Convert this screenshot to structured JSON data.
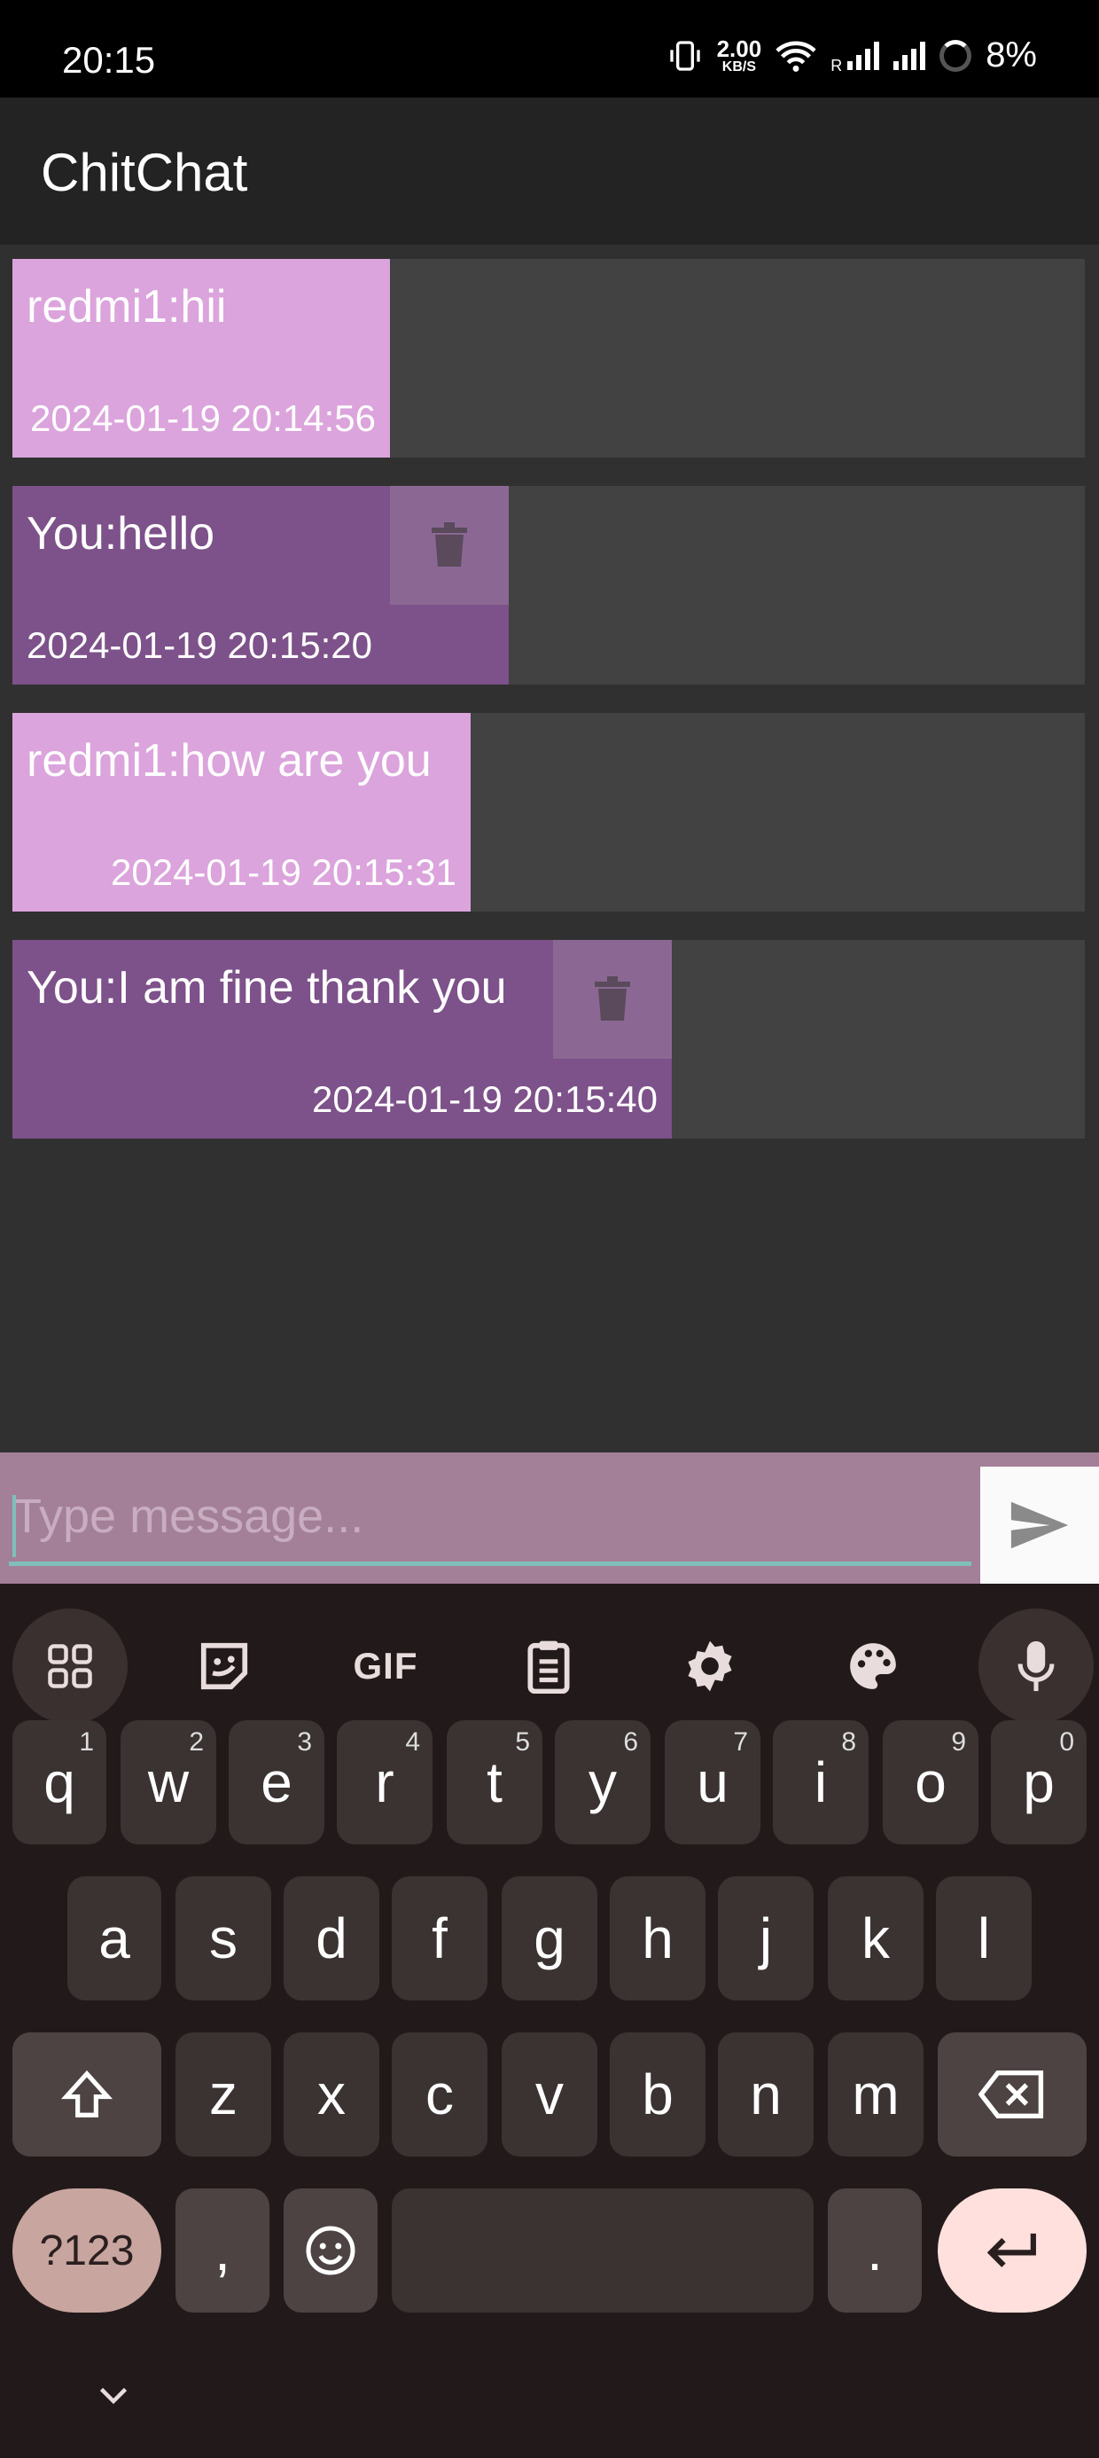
{
  "status_bar": {
    "time": "20:15",
    "net_speed_value": "2.00",
    "net_speed_unit": "KB/S",
    "roaming": "R",
    "battery": "8%"
  },
  "app_bar": {
    "title": "ChitChat"
  },
  "messages": [
    {
      "sender": "redmi1",
      "text": "redmi1:hii",
      "timestamp": "2024-01-19 20:14:56",
      "mine": false
    },
    {
      "sender": "You",
      "text": "You:hello",
      "timestamp": "2024-01-19 20:15:20",
      "mine": true
    },
    {
      "sender": "redmi1",
      "text": "redmi1:how are you",
      "timestamp": "2024-01-19 20:15:31",
      "mine": false
    },
    {
      "sender": "You",
      "text": "You:I am fine thank you",
      "timestamp": "2024-01-19 20:15:40",
      "mine": true
    }
  ],
  "composer": {
    "placeholder": "Type message...",
    "value": ""
  },
  "keyboard": {
    "toolbar": [
      "apps-grid-icon",
      "sticker-icon",
      "gif-icon",
      "clipboard-icon",
      "settings-icon",
      "palette-icon",
      "microphone-icon"
    ],
    "gif_label": "GIF",
    "row1": [
      {
        "k": "q",
        "n": "1"
      },
      {
        "k": "w",
        "n": "2"
      },
      {
        "k": "e",
        "n": "3"
      },
      {
        "k": "r",
        "n": "4"
      },
      {
        "k": "t",
        "n": "5"
      },
      {
        "k": "y",
        "n": "6"
      },
      {
        "k": "u",
        "n": "7"
      },
      {
        "k": "i",
        "n": "8"
      },
      {
        "k": "o",
        "n": "9"
      },
      {
        "k": "p",
        "n": "0"
      }
    ],
    "row2": [
      "a",
      "s",
      "d",
      "f",
      "g",
      "h",
      "j",
      "k",
      "l"
    ],
    "row3": [
      "z",
      "x",
      "c",
      "v",
      "b",
      "n",
      "m"
    ],
    "symbols_label": "?123",
    "comma": ",",
    "period": "."
  },
  "colors": {
    "their_bubble": "#dba4dc",
    "my_bubble": "#7d5189",
    "row_bg": "#424242",
    "chat_bg": "#303030",
    "input_bar": "#a47f98",
    "accent_line": "#7fbfba"
  }
}
